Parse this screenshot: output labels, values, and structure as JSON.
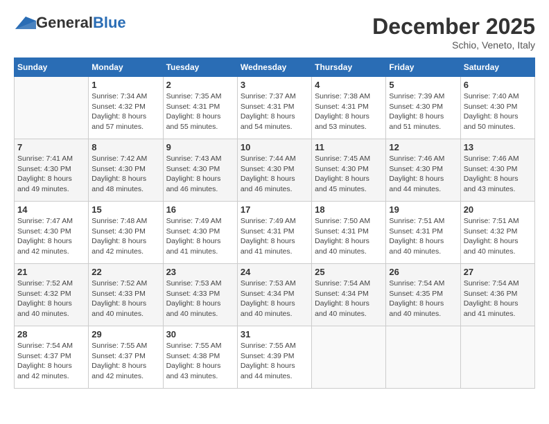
{
  "header": {
    "logo_general": "General",
    "logo_blue": "Blue",
    "month_title": "December 2025",
    "location": "Schio, Veneto, Italy"
  },
  "days_of_week": [
    "Sunday",
    "Monday",
    "Tuesday",
    "Wednesday",
    "Thursday",
    "Friday",
    "Saturday"
  ],
  "weeks": [
    [
      {
        "day": "",
        "empty": true
      },
      {
        "day": "1",
        "sunrise": "Sunrise: 7:34 AM",
        "sunset": "Sunset: 4:32 PM",
        "daylight": "Daylight: 8 hours and 57 minutes."
      },
      {
        "day": "2",
        "sunrise": "Sunrise: 7:35 AM",
        "sunset": "Sunset: 4:31 PM",
        "daylight": "Daylight: 8 hours and 55 minutes."
      },
      {
        "day": "3",
        "sunrise": "Sunrise: 7:37 AM",
        "sunset": "Sunset: 4:31 PM",
        "daylight": "Daylight: 8 hours and 54 minutes."
      },
      {
        "day": "4",
        "sunrise": "Sunrise: 7:38 AM",
        "sunset": "Sunset: 4:31 PM",
        "daylight": "Daylight: 8 hours and 53 minutes."
      },
      {
        "day": "5",
        "sunrise": "Sunrise: 7:39 AM",
        "sunset": "Sunset: 4:30 PM",
        "daylight": "Daylight: 8 hours and 51 minutes."
      },
      {
        "day": "6",
        "sunrise": "Sunrise: 7:40 AM",
        "sunset": "Sunset: 4:30 PM",
        "daylight": "Daylight: 8 hours and 50 minutes."
      }
    ],
    [
      {
        "day": "7",
        "sunrise": "Sunrise: 7:41 AM",
        "sunset": "Sunset: 4:30 PM",
        "daylight": "Daylight: 8 hours and 49 minutes."
      },
      {
        "day": "8",
        "sunrise": "Sunrise: 7:42 AM",
        "sunset": "Sunset: 4:30 PM",
        "daylight": "Daylight: 8 hours and 48 minutes."
      },
      {
        "day": "9",
        "sunrise": "Sunrise: 7:43 AM",
        "sunset": "Sunset: 4:30 PM",
        "daylight": "Daylight: 8 hours and 46 minutes."
      },
      {
        "day": "10",
        "sunrise": "Sunrise: 7:44 AM",
        "sunset": "Sunset: 4:30 PM",
        "daylight": "Daylight: 8 hours and 46 minutes."
      },
      {
        "day": "11",
        "sunrise": "Sunrise: 7:45 AM",
        "sunset": "Sunset: 4:30 PM",
        "daylight": "Daylight: 8 hours and 45 minutes."
      },
      {
        "day": "12",
        "sunrise": "Sunrise: 7:46 AM",
        "sunset": "Sunset: 4:30 PM",
        "daylight": "Daylight: 8 hours and 44 minutes."
      },
      {
        "day": "13",
        "sunrise": "Sunrise: 7:46 AM",
        "sunset": "Sunset: 4:30 PM",
        "daylight": "Daylight: 8 hours and 43 minutes."
      }
    ],
    [
      {
        "day": "14",
        "sunrise": "Sunrise: 7:47 AM",
        "sunset": "Sunset: 4:30 PM",
        "daylight": "Daylight: 8 hours and 42 minutes."
      },
      {
        "day": "15",
        "sunrise": "Sunrise: 7:48 AM",
        "sunset": "Sunset: 4:30 PM",
        "daylight": "Daylight: 8 hours and 42 minutes."
      },
      {
        "day": "16",
        "sunrise": "Sunrise: 7:49 AM",
        "sunset": "Sunset: 4:30 PM",
        "daylight": "Daylight: 8 hours and 41 minutes."
      },
      {
        "day": "17",
        "sunrise": "Sunrise: 7:49 AM",
        "sunset": "Sunset: 4:31 PM",
        "daylight": "Daylight: 8 hours and 41 minutes."
      },
      {
        "day": "18",
        "sunrise": "Sunrise: 7:50 AM",
        "sunset": "Sunset: 4:31 PM",
        "daylight": "Daylight: 8 hours and 40 minutes."
      },
      {
        "day": "19",
        "sunrise": "Sunrise: 7:51 AM",
        "sunset": "Sunset: 4:31 PM",
        "daylight": "Daylight: 8 hours and 40 minutes."
      },
      {
        "day": "20",
        "sunrise": "Sunrise: 7:51 AM",
        "sunset": "Sunset: 4:32 PM",
        "daylight": "Daylight: 8 hours and 40 minutes."
      }
    ],
    [
      {
        "day": "21",
        "sunrise": "Sunrise: 7:52 AM",
        "sunset": "Sunset: 4:32 PM",
        "daylight": "Daylight: 8 hours and 40 minutes."
      },
      {
        "day": "22",
        "sunrise": "Sunrise: 7:52 AM",
        "sunset": "Sunset: 4:33 PM",
        "daylight": "Daylight: 8 hours and 40 minutes."
      },
      {
        "day": "23",
        "sunrise": "Sunrise: 7:53 AM",
        "sunset": "Sunset: 4:33 PM",
        "daylight": "Daylight: 8 hours and 40 minutes."
      },
      {
        "day": "24",
        "sunrise": "Sunrise: 7:53 AM",
        "sunset": "Sunset: 4:34 PM",
        "daylight": "Daylight: 8 hours and 40 minutes."
      },
      {
        "day": "25",
        "sunrise": "Sunrise: 7:54 AM",
        "sunset": "Sunset: 4:34 PM",
        "daylight": "Daylight: 8 hours and 40 minutes."
      },
      {
        "day": "26",
        "sunrise": "Sunrise: 7:54 AM",
        "sunset": "Sunset: 4:35 PM",
        "daylight": "Daylight: 8 hours and 40 minutes."
      },
      {
        "day": "27",
        "sunrise": "Sunrise: 7:54 AM",
        "sunset": "Sunset: 4:36 PM",
        "daylight": "Daylight: 8 hours and 41 minutes."
      }
    ],
    [
      {
        "day": "28",
        "sunrise": "Sunrise: 7:54 AM",
        "sunset": "Sunset: 4:37 PM",
        "daylight": "Daylight: 8 hours and 42 minutes."
      },
      {
        "day": "29",
        "sunrise": "Sunrise: 7:55 AM",
        "sunset": "Sunset: 4:37 PM",
        "daylight": "Daylight: 8 hours and 42 minutes."
      },
      {
        "day": "30",
        "sunrise": "Sunrise: 7:55 AM",
        "sunset": "Sunset: 4:38 PM",
        "daylight": "Daylight: 8 hours and 43 minutes."
      },
      {
        "day": "31",
        "sunrise": "Sunrise: 7:55 AM",
        "sunset": "Sunset: 4:39 PM",
        "daylight": "Daylight: 8 hours and 44 minutes."
      },
      {
        "day": "",
        "empty": true
      },
      {
        "day": "",
        "empty": true
      },
      {
        "day": "",
        "empty": true
      }
    ]
  ]
}
